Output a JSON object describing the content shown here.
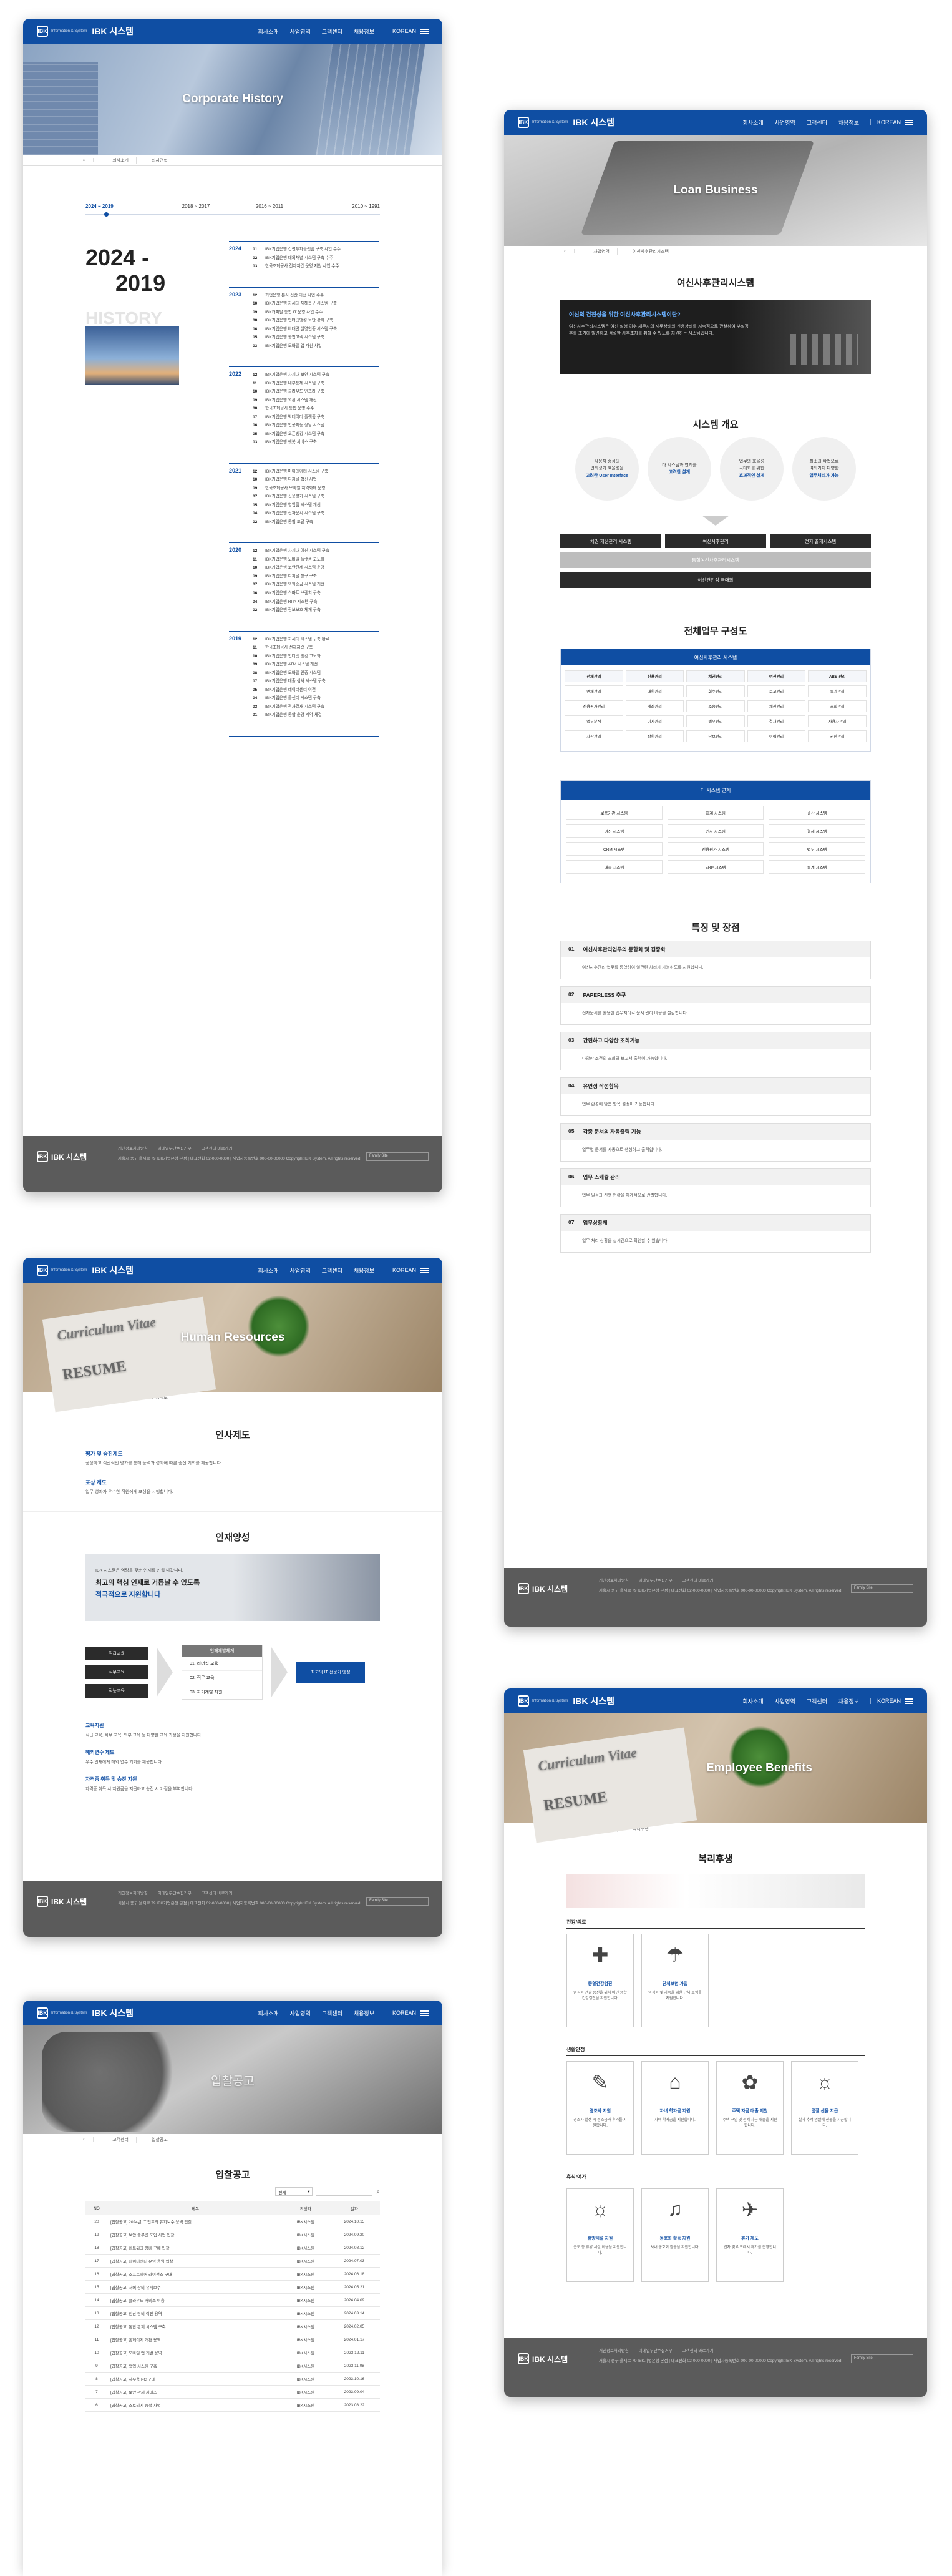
{
  "brand": {
    "logo_small": "Information & System",
    "logo_text": "IBK 시스템",
    "logo_mark": "IBK"
  },
  "nav": [
    "회사소개",
    "사업영역",
    "고객센터",
    "채용정보"
  ],
  "lang": "KOREAN",
  "crumb": {
    "home": "HOME",
    "l1": "회사소개",
    "l2": "회사연혁"
  },
  "history": {
    "hero": "Corporate History",
    "tabs": [
      "2024 ~ 2019",
      "2018 ~ 2017",
      "2016 ~ 2011",
      "2010 ~ 1991"
    ],
    "period_line1": "2024 -",
    "period_line2": "2019",
    "ghost": "HISTORY",
    "years": [
      {
        "y": "2024",
        "rows": [
          [
            "01",
            "IBK기업은행 간편투자플랫폼 구축 사업 수주"
          ],
          [
            "02",
            "IBK기업은행 대외채널 시스템 구축 수주"
          ],
          [
            "03",
            "한국조폐공사 전자지갑 운영 지원 사업 수주"
          ]
        ]
      },
      {
        "y": "2023",
        "rows": [
          [
            "12",
            "기업은행 본사 전산 이전 사업 수주"
          ],
          [
            "10",
            "IBK기업은행 차세대 재해복구 시스템 구축"
          ],
          [
            "09",
            "IBK캐피탈 통합 IT 운영 사업 수주"
          ],
          [
            "08",
            "IBK기업은행 인터넷뱅킹 보안 강화 구축"
          ],
          [
            "06",
            "IBK기업은행 비대면 실명인증 시스템 구축"
          ],
          [
            "05",
            "IBK기업은행 통합고객 시스템 구축"
          ],
          [
            "03",
            "IBK기업은행 모바일 앱 개선 사업"
          ]
        ]
      },
      {
        "y": "2022",
        "rows": [
          [
            "12",
            "IBK기업은행 차세대 보안 시스템 구축"
          ],
          [
            "11",
            "IBK기업은행 내부통제 시스템 구축"
          ],
          [
            "10",
            "IBK기업은행 클라우드 인프라 구축"
          ],
          [
            "09",
            "IBK기업은행 외환 시스템 개선"
          ],
          [
            "08",
            "한국조폐공사 통합 운영 수주"
          ],
          [
            "07",
            "IBK기업은행 빅데이터 플랫폼 구축"
          ],
          [
            "06",
            "IBK기업은행 인공지능 상담 시스템"
          ],
          [
            "05",
            "IBK기업은행 오픈뱅킹 시스템 구축"
          ],
          [
            "03",
            "IBK기업은행 챗봇 서비스 구축"
          ]
        ]
      },
      {
        "y": "2021",
        "rows": [
          [
            "12",
            "IBK기업은행 마이데이터 시스템 구축"
          ],
          [
            "10",
            "IBK기업은행 디지털 혁신 사업"
          ],
          [
            "09",
            "한국조폐공사 모바일 지역화폐 운영"
          ],
          [
            "07",
            "IBK기업은행 신용평가 시스템 구축"
          ],
          [
            "05",
            "IBK기업은행 영업점 시스템 개선"
          ],
          [
            "04",
            "IBK기업은행 전자문서 시스템 구축"
          ],
          [
            "02",
            "IBK기업은행 통합 포털 구축"
          ]
        ]
      },
      {
        "y": "2020",
        "rows": [
          [
            "12",
            "IBK기업은행 차세대 여신 시스템 구축"
          ],
          [
            "11",
            "IBK기업은행 모바일 플랫폼 고도화"
          ],
          [
            "10",
            "IBK기업은행 보안관제 시스템 운영"
          ],
          [
            "09",
            "IBK기업은행 디지털 창구 구축"
          ],
          [
            "07",
            "IBK기업은행 외화송금 시스템 개선"
          ],
          [
            "06",
            "IBK기업은행 스마트 브랜치 구축"
          ],
          [
            "04",
            "IBK기업은행 RPA 시스템 구축"
          ],
          [
            "02",
            "IBK기업은행 정보보호 체계 구축"
          ]
        ]
      },
      {
        "y": "2019",
        "rows": [
          [
            "12",
            "IBK기업은행 차세대 시스템 구축 완료"
          ],
          [
            "11",
            "한국조폐공사 전자지갑 구축"
          ],
          [
            "10",
            "IBK기업은행 인터넷 뱅킹 고도화"
          ],
          [
            "09",
            "IBK기업은행 ATM 시스템 개선"
          ],
          [
            "08",
            "IBK기업은행 모바일 인증 시스템"
          ],
          [
            "07",
            "IBK기업은행 대출 심사 시스템 구축"
          ],
          [
            "05",
            "IBK기업은행 데이터센터 이전"
          ],
          [
            "04",
            "IBK기업은행 콜센터 시스템 구축"
          ],
          [
            "03",
            "IBK기업은행 전자결재 시스템 구축"
          ],
          [
            "01",
            "IBK기업은행 통합 운영 계약 체결"
          ]
        ]
      }
    ]
  },
  "loan": {
    "hero": "Loan Business",
    "title": "여신사후관리시스템",
    "intro_head": "여신의 건전성을 위한 여신사후관리시스템이란?",
    "intro_body": "여신사후관리시스템은 여신 실행 이후 채무자의 재무상태와 신용상태를 지속적으로 관찰하여 부실징후를 조기에 발견하고 적절한 사후조치를 취할 수 있도록 지원하는 시스템입니다.",
    "overview": "시스템 개요",
    "circles": [
      [
        "사용자 중심의",
        "편리성과 효율성을",
        "고려한 User Interface"
      ],
      [
        "타 시스템과 연계를",
        "고려한 설계",
        ""
      ],
      [
        "업무의 효율성",
        "극대화를 위한",
        "효과적인 설계"
      ],
      [
        "최소의 작업으로",
        "여러가지 다양한",
        "업무처리가 가능"
      ]
    ],
    "bars": [
      "채권 재산관리 시스템",
      "여신사후관리",
      "전자 결재시스템"
    ],
    "gray1": "통합여신사후관리시스템",
    "dark1": "여신건전성 극대화",
    "org": "전체업무 구성도",
    "org_head": "여신사후관리 시스템",
    "org_cols": [
      [
        "전체관리",
        "연체관리",
        "신용평가관리",
        "업무분석",
        "자산관리"
      ],
      [
        "신용관리",
        "대환관리",
        "계좌관리",
        "이자관리",
        "상환관리"
      ],
      [
        "채권관리",
        "회수관리",
        "소송관리",
        "법무관리",
        "담보관리"
      ],
      [
        "여신관리",
        "보고관리",
        "채권관리",
        "결재관리",
        "이력관리"
      ],
      [
        "ABS 관리",
        "통계관리",
        "조회관리",
        "사용자관리",
        "권한관리"
      ]
    ],
    "link_head": "타 시스템 연계",
    "link_items": [
      "보증기관 시스템",
      "회계 시스템",
      "결산 시스템",
      "여신 시스템",
      "인사 시스템",
      "결재 시스템",
      "CRM 시스템",
      "신용평가 시스템",
      "법무 시스템",
      "대출 시스템",
      "ERP 시스템",
      "통계 시스템"
    ],
    "feat": "특징 및 장점",
    "feats": [
      [
        "01",
        "여신사후관리업무의 통합화 및 집중화",
        "여신사후관리 업무를 통합하여 일관된 처리가 가능하도록 지원합니다."
      ],
      [
        "02",
        "PAPERLESS 추구",
        "전자문서를 활용한 업무처리로 문서 관리 비용을 절감합니다."
      ],
      [
        "03",
        "간편하고 다양한 조회기능",
        "다양한 조건의 조회와 보고서 출력이 가능합니다."
      ],
      [
        "04",
        "유연성 작성항목",
        "업무 환경에 맞춘 항목 설정이 가능합니다."
      ],
      [
        "05",
        "각종 문서의 자동출력 기능",
        "업무별 문서를 자동으로 생성하고 출력합니다."
      ],
      [
        "06",
        "업무 스케쥴 관리",
        "업무 일정과 진행 현황을 체계적으로 관리합니다."
      ],
      [
        "07",
        "업무상황체",
        "업무 처리 상황을 실시간으로 확인할 수 있습니다."
      ]
    ]
  },
  "hr": {
    "hero": "Human Resources",
    "crumb": "채용정보",
    "title": "인사제도",
    "sub1": "평가 및 승진제도",
    "sub1_body": "공정하고 객관적인 평가를 통해 능력과 성과에 따른 승진 기회를 제공합니다.",
    "sub2": "포상 제도",
    "sub2_body": "업무 성과가 우수한 직원에게 포상을 시행합니다.",
    "dev": "인재양성",
    "dev_banner": "IBK 시스템은 역량을 갖춘 인재를 키워 나갑니다.",
    "dev_banner2": "최고의 핵심 인재로 거듭날 수 있도록",
    "dev_banner3": "적극적으로 지원합니다",
    "left": [
      "직급교육",
      "직무교육",
      "직능교육"
    ],
    "mid_head": "인재개발체계",
    "mid": [
      "01. 리더십 교육",
      "02. 직무 교육",
      "03. 자기계발 지원"
    ],
    "right": "최고의 IT 전문가 양성",
    "items": [
      [
        "교육지원",
        "직급 교육, 직무 교육, 외부 교육 등 다양한 교육 과정을 지원합니다."
      ],
      [
        "해외연수 제도",
        "우수 인재에게 해외 연수 기회를 제공합니다."
      ],
      [
        "자격증 취득 및 승진 지원",
        "자격증 취득 시 지원금을 지급하고 승진 시 가점을 부여합니다."
      ]
    ]
  },
  "benefits": {
    "hero": "Employee Benefits",
    "title": "복리후생",
    "g1": "건강/의료",
    "g1_items": [
      [
        "종합건강검진",
        "임직원 건강 증진을 위해 매년 종합 건강검진을 지원합니다."
      ],
      [
        "단체보험 가입",
        "임직원 및 가족을 위한 단체 보험을 지원합니다."
      ]
    ],
    "g2": "생활안정",
    "g2_items": [
      [
        "경조사 지원",
        "경조사 발생 시 경조금과 휴가를 지원합니다."
      ],
      [
        "자녀 학자금 지원",
        "자녀 학자금을 지원합니다."
      ],
      [
        "주택 자금 대출 지원",
        "주택 구입 및 전세 자금 대출을 지원합니다."
      ],
      [
        "명절 선물 지급",
        "설과 추석 명절에 선물을 지급합니다."
      ]
    ],
    "g3": "휴식/여가",
    "g3_items": [
      [
        "휴양시설 지원",
        "콘도 등 휴양 시설 이용을 지원합니다."
      ],
      [
        "동호회 활동 지원",
        "사내 동호회 활동을 지원합니다."
      ],
      [
        "휴가 제도",
        "연차 및 리프레시 휴가를 운영합니다."
      ]
    ]
  },
  "recruit": {
    "hero": "입찰공고",
    "title": "입찰공고",
    "select": "전체",
    "cols": [
      "NO",
      "제목",
      "작성자",
      "일자"
    ],
    "rows": [
      [
        "20",
        "[입찰공고] 2024년 IT 인프라 유지보수 용역 입찰",
        "IBK시스템",
        "2024.10.15"
      ],
      [
        "19",
        "[입찰공고] 보안 솔루션 도입 사업 입찰",
        "IBK시스템",
        "2024.09.20"
      ],
      [
        "18",
        "[입찰공고] 네트워크 장비 구매 입찰",
        "IBK시스템",
        "2024.08.12"
      ],
      [
        "17",
        "[입찰공고] 데이터센터 운영 용역 입찰",
        "IBK시스템",
        "2024.07.03"
      ],
      [
        "16",
        "[입찰공고] 소프트웨어 라이선스 구매",
        "IBK시스템",
        "2024.06.18"
      ],
      [
        "15",
        "[입찰공고] 서버 장비 유지보수",
        "IBK시스템",
        "2024.05.21"
      ],
      [
        "14",
        "[입찰공고] 클라우드 서비스 이용",
        "IBK시스템",
        "2024.04.09"
      ],
      [
        "13",
        "[입찰공고] 전산 장비 이전 용역",
        "IBK시스템",
        "2024.03.14"
      ],
      [
        "12",
        "[입찰공고] 통합 관제 시스템 구축",
        "IBK시스템",
        "2024.02.05"
      ],
      [
        "11",
        "[입찰공고] 홈페이지 개편 용역",
        "IBK시스템",
        "2024.01.17"
      ],
      [
        "10",
        "[입찰공고] 모바일 앱 개발 용역",
        "IBK시스템",
        "2023.12.11"
      ],
      [
        "9",
        "[입찰공고] 백업 시스템 구축",
        "IBK시스템",
        "2023.11.08"
      ],
      [
        "8",
        "[입찰공고] 사무용 PC 구매",
        "IBK시스템",
        "2023.10.16"
      ],
      [
        "7",
        "[입찰공고] 보안 관제 서비스",
        "IBK시스템",
        "2023.09.04"
      ],
      [
        "6",
        "[입찰공고] 스토리지 증설 사업",
        "IBK시스템",
        "2023.08.22"
      ]
    ]
  },
  "footer": {
    "links": [
      "개인정보처리방침",
      "이메일무단수집거부",
      "고객센터 바로가기"
    ],
    "addr": "서울시 중구 을지로 79 IBK기업은행 본점 | 대표전화 02-000-0000 | 사업자등록번호 000-00-00000 Copyright IBK System. All rights reserved.",
    "family": "Family Site"
  },
  "colors": {
    "primary": "#0f4ea3",
    "footer": "#5b5b5b",
    "dark": "#2b2b2b"
  }
}
